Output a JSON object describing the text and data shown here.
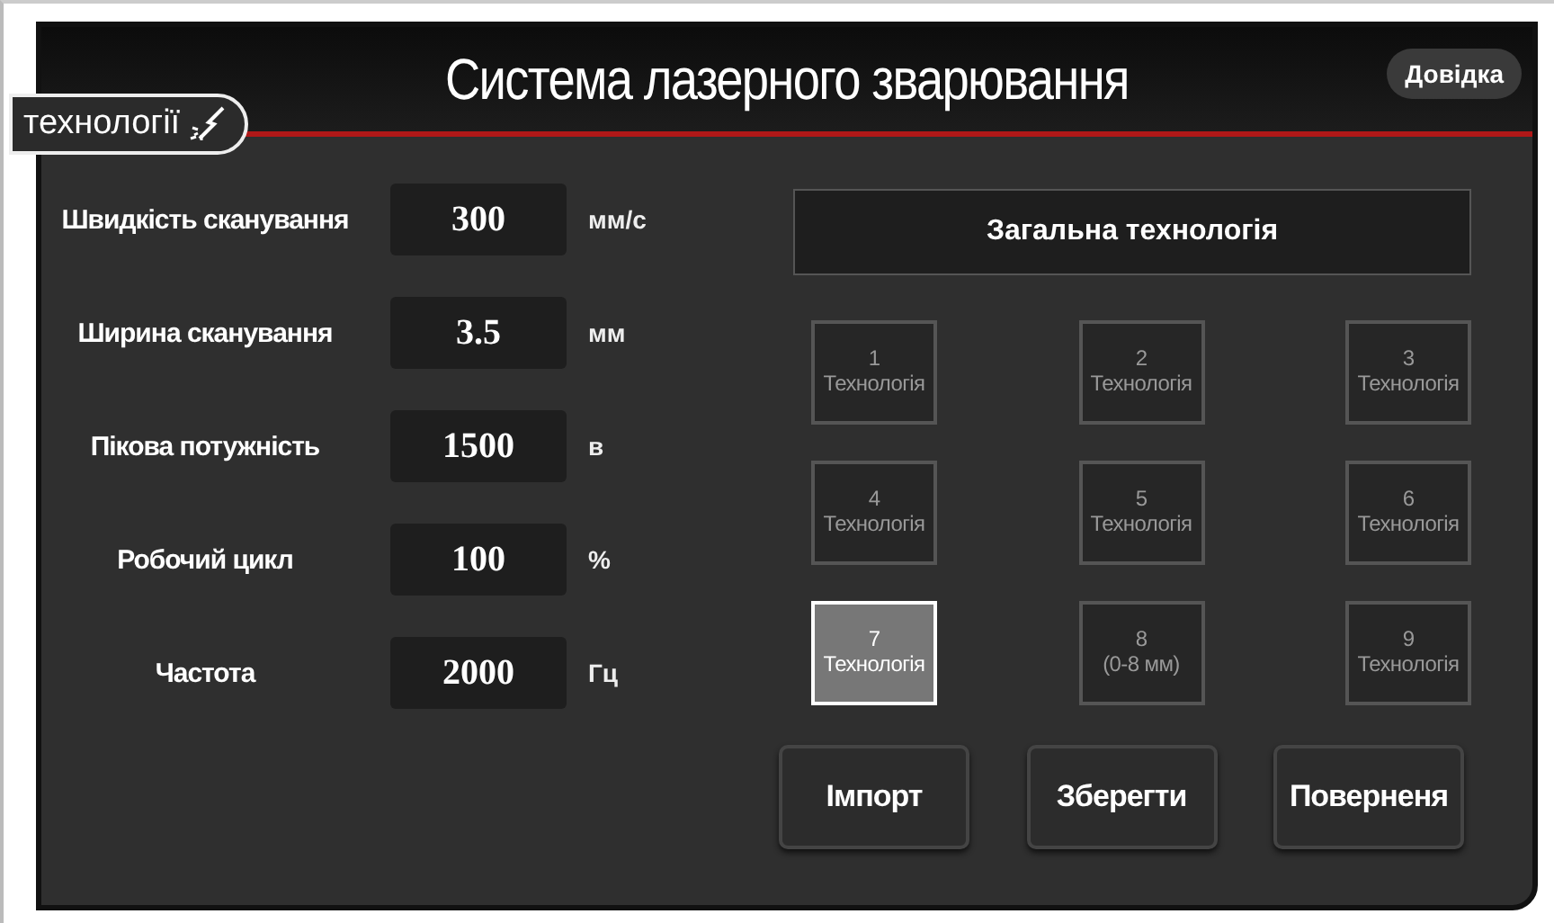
{
  "header": {
    "title": "Система лазерного зварювання",
    "help_button": "Довідка",
    "tag": "технології"
  },
  "parameters": [
    {
      "label": "Швидкість сканування",
      "value": "300",
      "unit": "мм/с"
    },
    {
      "label": "Ширина сканування",
      "value": "3.5",
      "unit": "мм"
    },
    {
      "label": "Пікова потужність",
      "value": "1500",
      "unit": "в"
    },
    {
      "label": "Робочий цикл",
      "value": "100",
      "unit": "%"
    },
    {
      "label": "Частота",
      "value": "2000",
      "unit": "Гц"
    }
  ],
  "general_button": "Загальна технологія",
  "technologies": [
    {
      "number": "1",
      "label": "Технологія",
      "selected": false
    },
    {
      "number": "2",
      "label": "Технологія",
      "selected": false
    },
    {
      "number": "3",
      "label": "Технологія",
      "selected": false
    },
    {
      "number": "4",
      "label": "Технологія",
      "selected": false
    },
    {
      "number": "5",
      "label": "Технологія",
      "selected": false
    },
    {
      "number": "6",
      "label": "Технологія",
      "selected": false
    },
    {
      "number": "7",
      "label": "Технологія",
      "selected": true
    },
    {
      "number": "8",
      "label": "(0-8 мм)",
      "selected": false
    },
    {
      "number": "9",
      "label": "Технологія",
      "selected": false
    }
  ],
  "actions": [
    "Імпорт",
    "Зберегти",
    "Поверненя"
  ]
}
